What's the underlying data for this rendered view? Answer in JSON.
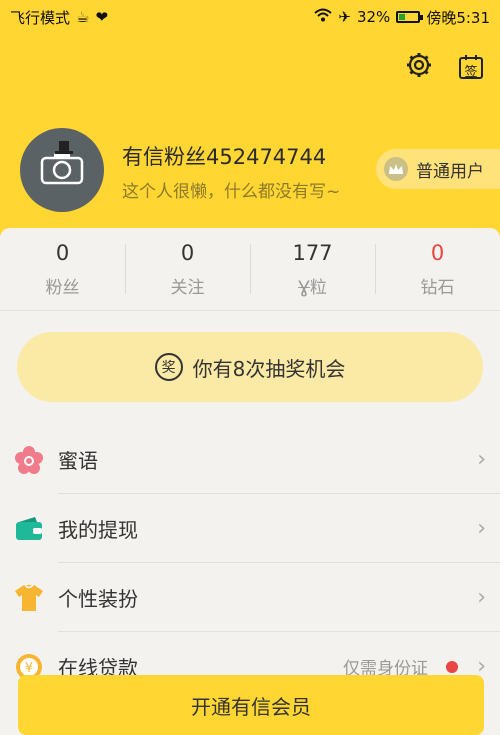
{
  "status_bar": {
    "mode": "飞行模式",
    "battery": "32%",
    "time": "傍晚5:31",
    "battery_level": 0.32
  },
  "header": {
    "settings_icon": "gear-icon",
    "checkin_icon": "calendar-sign-icon",
    "checkin_label": "签"
  },
  "profile": {
    "name": "有信粉丝452474744",
    "bio": "这个人很懒，什么都没有写~",
    "user_level": "普通用户"
  },
  "stats": [
    {
      "value": "0",
      "label": "粉丝"
    },
    {
      "value": "0",
      "label": "关注"
    },
    {
      "value": "177",
      "label": "粒"
    },
    {
      "value": "0",
      "label": "钻石"
    }
  ],
  "lottery": {
    "icon_char": "奖",
    "text": "你有8次抽奖机会"
  },
  "menu": [
    {
      "label": "蜜语",
      "icon": "flower-icon"
    },
    {
      "label": "我的提现",
      "icon": "wallet-icon"
    },
    {
      "label": "个性装扮",
      "icon": "shirt-icon"
    },
    {
      "label": "在线贷款",
      "icon": "yen-coin-icon",
      "note": "仅需身份证"
    }
  ],
  "cta": {
    "label": "开通有信会员"
  },
  "colors": {
    "brand_yellow": "#ffd632",
    "accent_red": "#e5473f"
  }
}
